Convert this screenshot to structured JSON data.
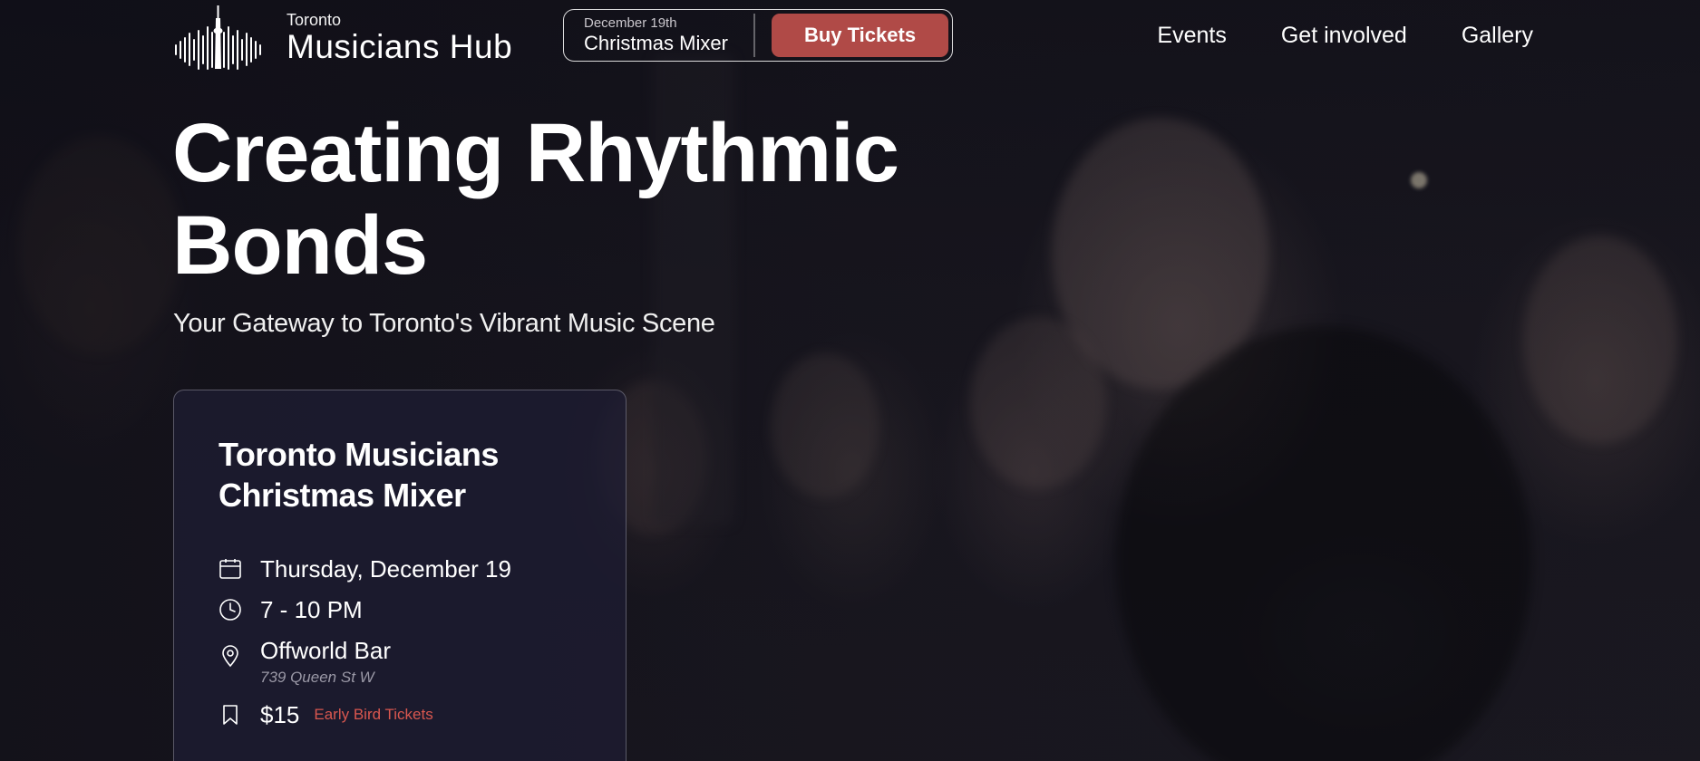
{
  "brand": {
    "city": "Toronto",
    "name": "Musicians Hub"
  },
  "promo": {
    "date": "December 19th",
    "event": "Christmas Mixer",
    "button_label": "Buy Tickets",
    "button_color": "#b04a47"
  },
  "nav": {
    "items": [
      {
        "label": "Events"
      },
      {
        "label": "Get involved"
      },
      {
        "label": "Gallery"
      }
    ]
  },
  "hero": {
    "headline": "Creating Rhythmic Bonds",
    "subheadline": "Your Gateway to Toronto's Vibrant Music Scene"
  },
  "event_card": {
    "title": "Toronto Musicians Christmas Mixer",
    "date": "Thursday, December 19",
    "time": "7 - 10 PM",
    "venue": "Offworld Bar",
    "address": "739 Queen St W",
    "price": "$15",
    "price_note": "Early Bird Tickets",
    "accent_color": "#d9574f"
  },
  "icons": {
    "logo": "soundwave-cn-tower-icon",
    "date": "calendar-icon",
    "time": "clock-icon",
    "venue": "map-pin-icon",
    "price": "bookmark-icon"
  }
}
